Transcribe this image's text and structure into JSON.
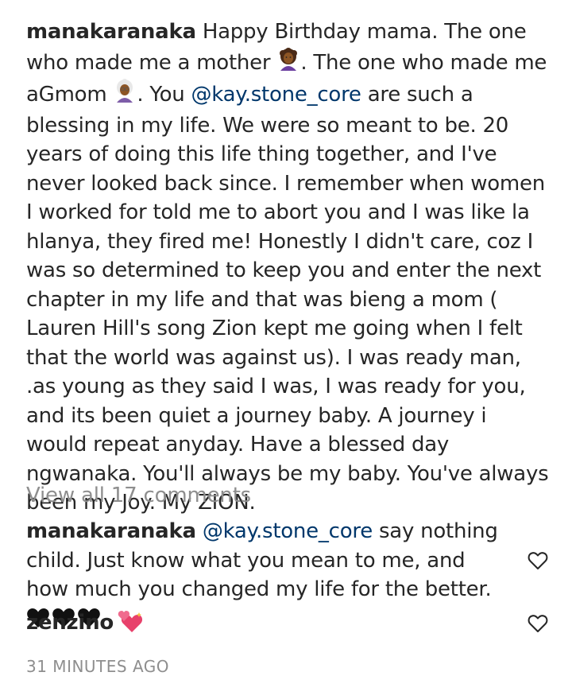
{
  "post": {
    "caption": {
      "username": "manakaranaka",
      "part1": "Happy Birthday mama. The one who made me a mother ",
      "part2": ". The one who made me aGmom ",
      "part3": ". You ",
      "mention": "@kay.stone_core",
      "part4": " are such a blessing in my life. We were so meant to be. 20 years of doing this life thing together, and I've never looked back since. I remember when women I worked for told me to abort you and I was like la hlanya, they fired me! Honestly I didn't care, coz I was so determined to keep you and enter the next chapter in my life and that was bieng a mom ( Lauren Hill's song Zion kept me going when I felt that the world was against us). I was ready man, .as young as they said I was, I was ready for you, and its been quiet a journey baby. A journey i would repeat anyday. Have a blessed day ngwanaka. You'll always be my baby. You've always been my Joy. My ZION.",
      "emoji1": "woman-curly-hair-emoji",
      "emoji2": "old-woman-emoji"
    },
    "view_all_comments": "View all 17 comments",
    "comments": [
      {
        "username": "manakaranaka",
        "mention": "@kay.stone_core",
        "text": " say nothing child. Just know what you mean to me, and how much you changed my life for the better. ",
        "emoji": "black-hearts-x3"
      },
      {
        "username": "zenzino",
        "text": "",
        "emoji": "sparkling-heart-emoji"
      }
    ],
    "timestamp": "31 MINUTES AGO"
  },
  "colors": {
    "text": "#262626",
    "mention": "#00376b",
    "muted": "#8e8e8e",
    "skin": "#8d5524",
    "hair_dark": "#3b2314",
    "heart_pink": "#e8416b"
  }
}
